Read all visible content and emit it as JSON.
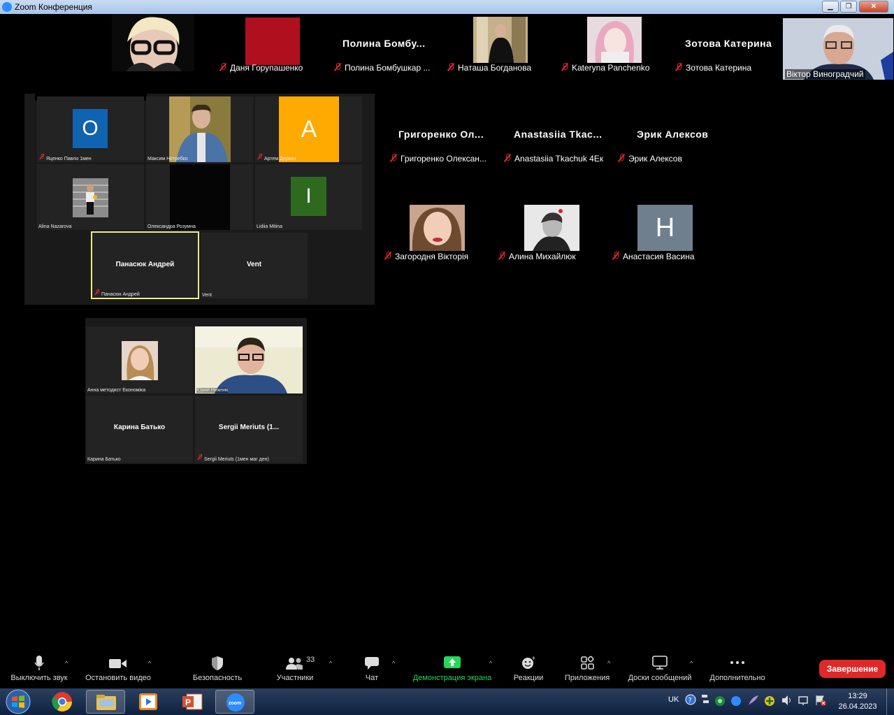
{
  "window": {
    "title": "Zoom Конференция"
  },
  "top_strip": [
    {
      "name": "Даня Горупашенко",
      "muted": true
    },
    {
      "display": "Полина  Бомбу...",
      "name": "Полина Бомбушкар ...",
      "muted": true
    },
    {
      "name": "Наташа Богданова",
      "muted": true
    },
    {
      "name": "Kateryna Panchenko",
      "muted": true
    },
    {
      "display": "Зотова Катерина",
      "name": "Зотова Катерина",
      "muted": true
    },
    {
      "name": "Віктор Виноградчий",
      "muted": false
    }
  ],
  "gallery_panel_1": [
    {
      "name": "Яценко Павло 1мен",
      "letter": "О",
      "color": "#0f63b0",
      "muted": true
    },
    {
      "name": "Максим Нетребко",
      "muted": false
    },
    {
      "name": "Артем Деркач",
      "letter": "A",
      "color": "#ffaa00",
      "muted": true
    },
    {
      "name": "Alina Nazarova",
      "muted": false
    },
    {
      "name": "Олександра Розумна",
      "muted": false
    },
    {
      "name": "Lidiia Mitina",
      "letter": "I",
      "color": "#2e6a1e",
      "muted": false
    },
    {
      "display": "Панасюк Андрей",
      "name": "Панасюк Андрей",
      "muted": true,
      "active_speaker": true
    },
    {
      "display": "Vent",
      "name": "Vent",
      "muted": false
    }
  ],
  "gallery_panel_2": [
    {
      "name": "Анна методист Економіка",
      "muted": false
    },
    {
      "name": "Юрий Нижник",
      "muted": false
    },
    {
      "display": "Карина Батько",
      "name": "Карина Батько",
      "muted": false
    },
    {
      "display": "Sergii Meriuts (1...",
      "name": "Sergii Meriuts (1мен маг ден)",
      "muted": true
    }
  ],
  "right_row_1": [
    {
      "display": "Григоренко  Ол...",
      "name": "Григоренко Олексан...",
      "muted": true
    },
    {
      "display": "Anastasiia  Tkac...",
      "name": "Anastasiia Tkachuk 4Ек",
      "muted": true
    },
    {
      "display": "Эрик Алексов",
      "name": "Эрик Алексов",
      "muted": true
    }
  ],
  "right_row_2": [
    {
      "name": "Загородня Вікторія",
      "muted": true
    },
    {
      "name": "Алина Михайлюк",
      "muted": true
    },
    {
      "name": "Анастасия Васина",
      "letter": "H",
      "color": "#6f7f8e",
      "muted": true
    }
  ],
  "toolbar": {
    "mute": "Выключить звук",
    "video": "Остановить видео",
    "security": "Безопасность",
    "participants": "Участники",
    "participants_count": "33",
    "chat": "Чат",
    "share": "Демонстрация экрана",
    "reactions": "Реакции",
    "apps": "Приложения",
    "whiteboards": "Доски сообщений",
    "more": "Дополнительно",
    "end": "Завершение",
    "share_color": "#23d959",
    "end_color": "#e02828"
  },
  "taskbar": {
    "apps": [
      "windows-start-icon",
      "chrome-icon",
      "explorer-icon",
      "media-player-icon",
      "powerpoint-icon",
      "zoom-icon"
    ],
    "zoom_app_label": "zoom",
    "lang": "UK",
    "time": "13:29",
    "date": "26.04.2023"
  }
}
